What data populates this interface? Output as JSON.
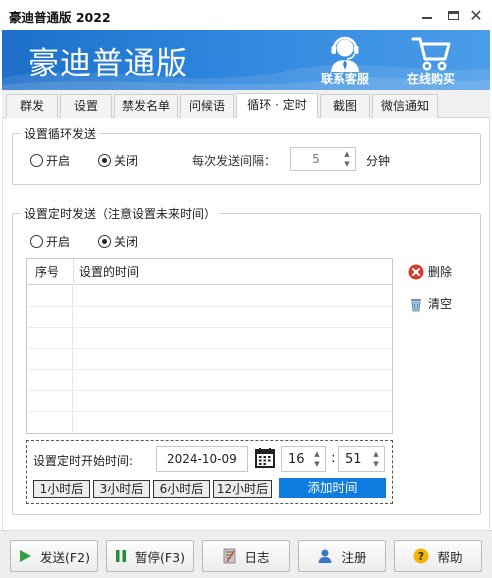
{
  "window": {
    "title": "豪迪普通版 2022"
  },
  "banner": {
    "title": "豪迪普通版",
    "support_label": "联系客服",
    "shop_label": "在线购买"
  },
  "tabs": [
    "群发",
    "设置",
    "禁发名单",
    "问候语",
    "循环 · 定时",
    "截图",
    "微信通知"
  ],
  "active_tab": "循环 · 定时",
  "loop": {
    "group_title": "设置循环发送",
    "on_label": "开启",
    "off_label": "关闭",
    "selected": "关闭",
    "interval_label": "每次发送间隔：",
    "interval_value": "5",
    "unit": "分钟"
  },
  "timed": {
    "group_title": "设置定时发送（注意设置未来时间）",
    "on_label": "开启",
    "off_label": "关闭",
    "selected": "关闭",
    "columns": [
      "序号",
      "设置的时间"
    ],
    "rows": [],
    "delete_label": "删除",
    "clear_label": "清空",
    "start_label": "设置定时开始时间:",
    "date_value": "2024-10-09",
    "hour_value": "16",
    "minute_value": "51",
    "time_sep": ":",
    "quick_buttons": [
      "1小时后",
      "3小时后",
      "6小时后",
      "12小时后"
    ],
    "add_label": "添加时间"
  },
  "footer": {
    "send": "发送(F2)",
    "pause": "暂停(F3)",
    "log": "日志",
    "register": "注册",
    "help": "帮助"
  },
  "colors": {
    "accent": "#0e7be0",
    "banner": "#2f86de",
    "delete_icon": "#d83b2f",
    "send_icon": "#2ea043",
    "pause_icon": "#2a8a3a"
  },
  "icons": {
    "support": "headset-agent-icon",
    "shop": "shopping-cart-icon",
    "delete": "red-x-icon",
    "clear": "trash-can-icon",
    "calendar": "calendar-icon",
    "send": "play-icon",
    "pause": "pause-icon",
    "log": "notebook-icon",
    "register": "user-icon",
    "help": "question-icon"
  }
}
